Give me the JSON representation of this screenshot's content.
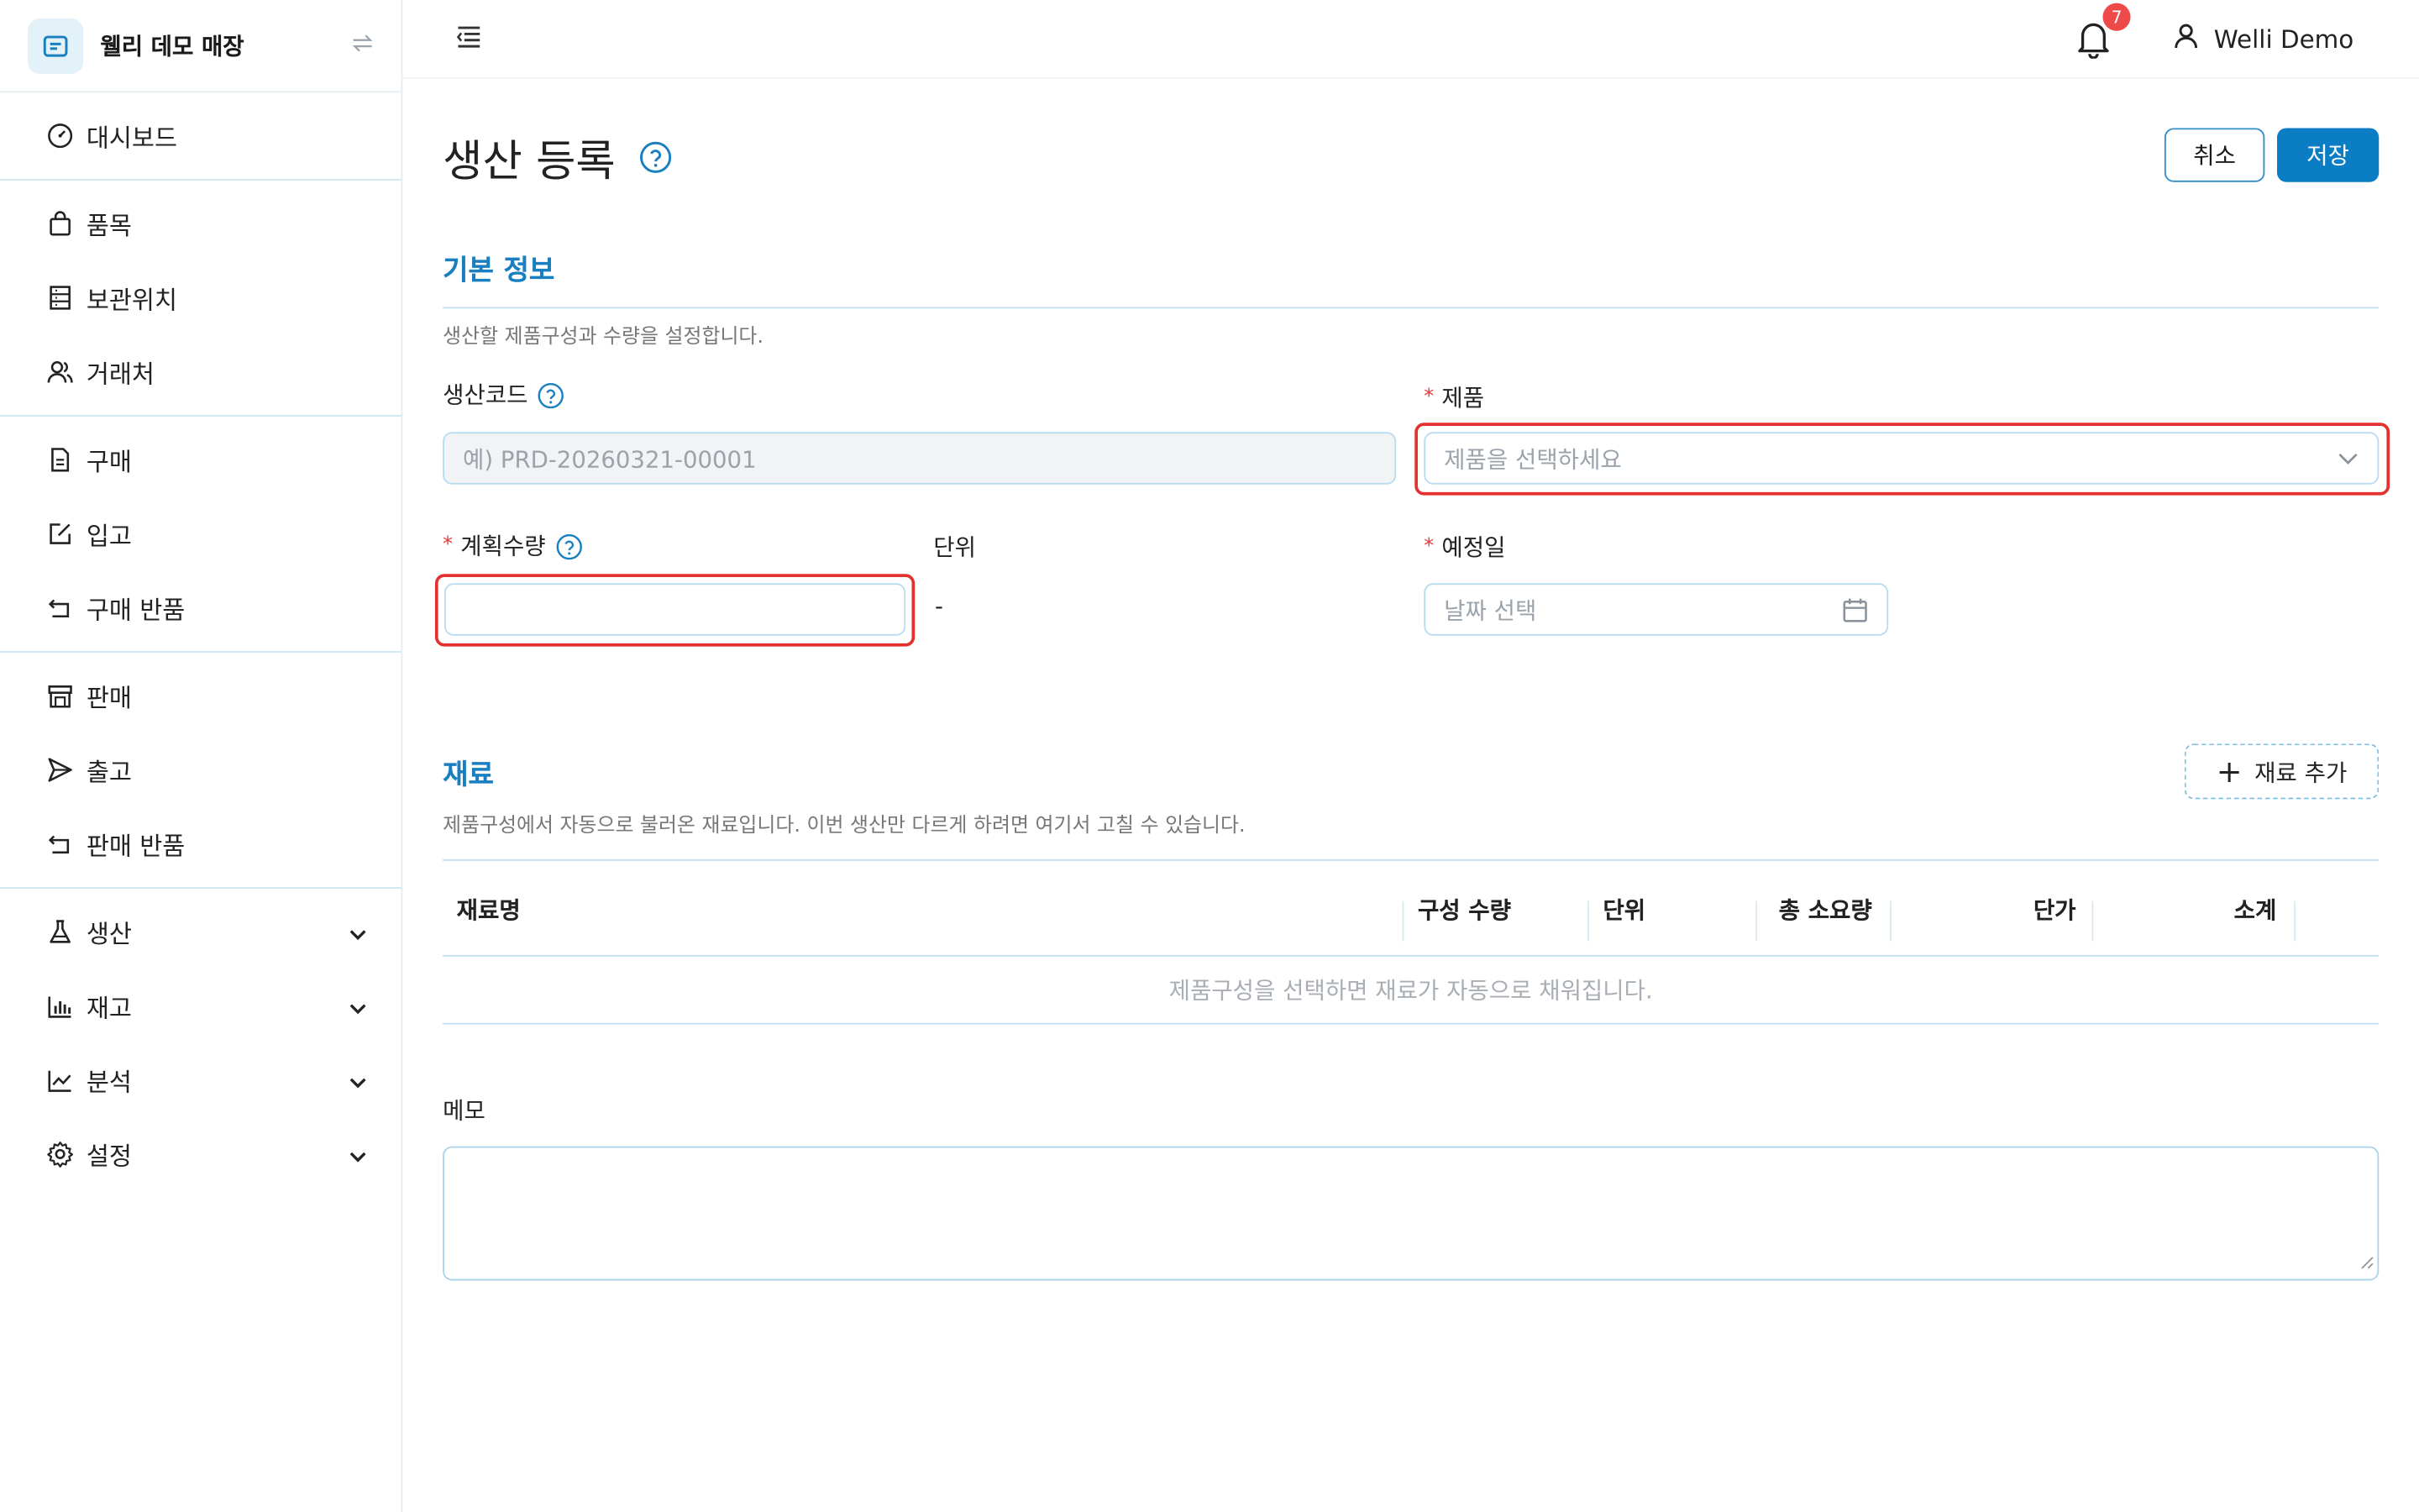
{
  "sidebar": {
    "store_name": "웰리 데모 매장",
    "items": [
      {
        "label": "대시보드",
        "icon": "dashboard-gauge-icon"
      },
      {
        "label": "품목",
        "icon": "shopping-bag-icon"
      },
      {
        "label": "보관위치",
        "icon": "shelf-icon"
      },
      {
        "label": "거래처",
        "icon": "users-icon"
      },
      {
        "label": "구매",
        "icon": "document-icon"
      },
      {
        "label": "입고",
        "icon": "edit-in-box-icon"
      },
      {
        "label": "구매 반품",
        "icon": "return-arrow-icon"
      },
      {
        "label": "판매",
        "icon": "store-icon"
      },
      {
        "label": "출고",
        "icon": "send-icon"
      },
      {
        "label": "판매 반품",
        "icon": "return-arrow-icon"
      },
      {
        "label": "생산",
        "icon": "flask-icon"
      },
      {
        "label": "재고",
        "icon": "bar-chart-icon"
      },
      {
        "label": "분석",
        "icon": "line-chart-icon"
      },
      {
        "label": "설정",
        "icon": "gear-icon"
      }
    ]
  },
  "topbar": {
    "notification_count": "7",
    "user_name": "Welli Demo"
  },
  "page": {
    "title": "생산 등록",
    "cancel_label": "취소",
    "save_label": "저장"
  },
  "basic_info": {
    "title": "기본 정보",
    "description": "생산할 제품구성과 수량을 설정합니다.",
    "production_code_label": "생산코드",
    "production_code_placeholder": "예) PRD-20260321-00001",
    "product_label": "제품",
    "product_placeholder": "제품을 선택하세요",
    "planned_qty_label": "계획수량",
    "planned_qty_value": "",
    "unit_label": "단위",
    "unit_value": "-",
    "scheduled_date_label": "예정일",
    "scheduled_date_placeholder": "날짜 선택"
  },
  "materials": {
    "title": "재료",
    "description": "제품구성에서 자동으로 불러온 재료입니다. 이번 생산만 다르게 하려면 여기서 고칠 수 있습니다.",
    "add_label": "재료 추가",
    "columns": [
      "재료명",
      "구성 수량",
      "단위",
      "총 소요량",
      "단가",
      "소계"
    ],
    "empty_text": "제품구성을 선택하면 재료가 자동으로 채워집니다."
  },
  "memo": {
    "label": "메모",
    "value": ""
  },
  "colors": {
    "accent": "#0b7dc4",
    "error": "#e3312f",
    "badge": "#ef4a4a"
  }
}
